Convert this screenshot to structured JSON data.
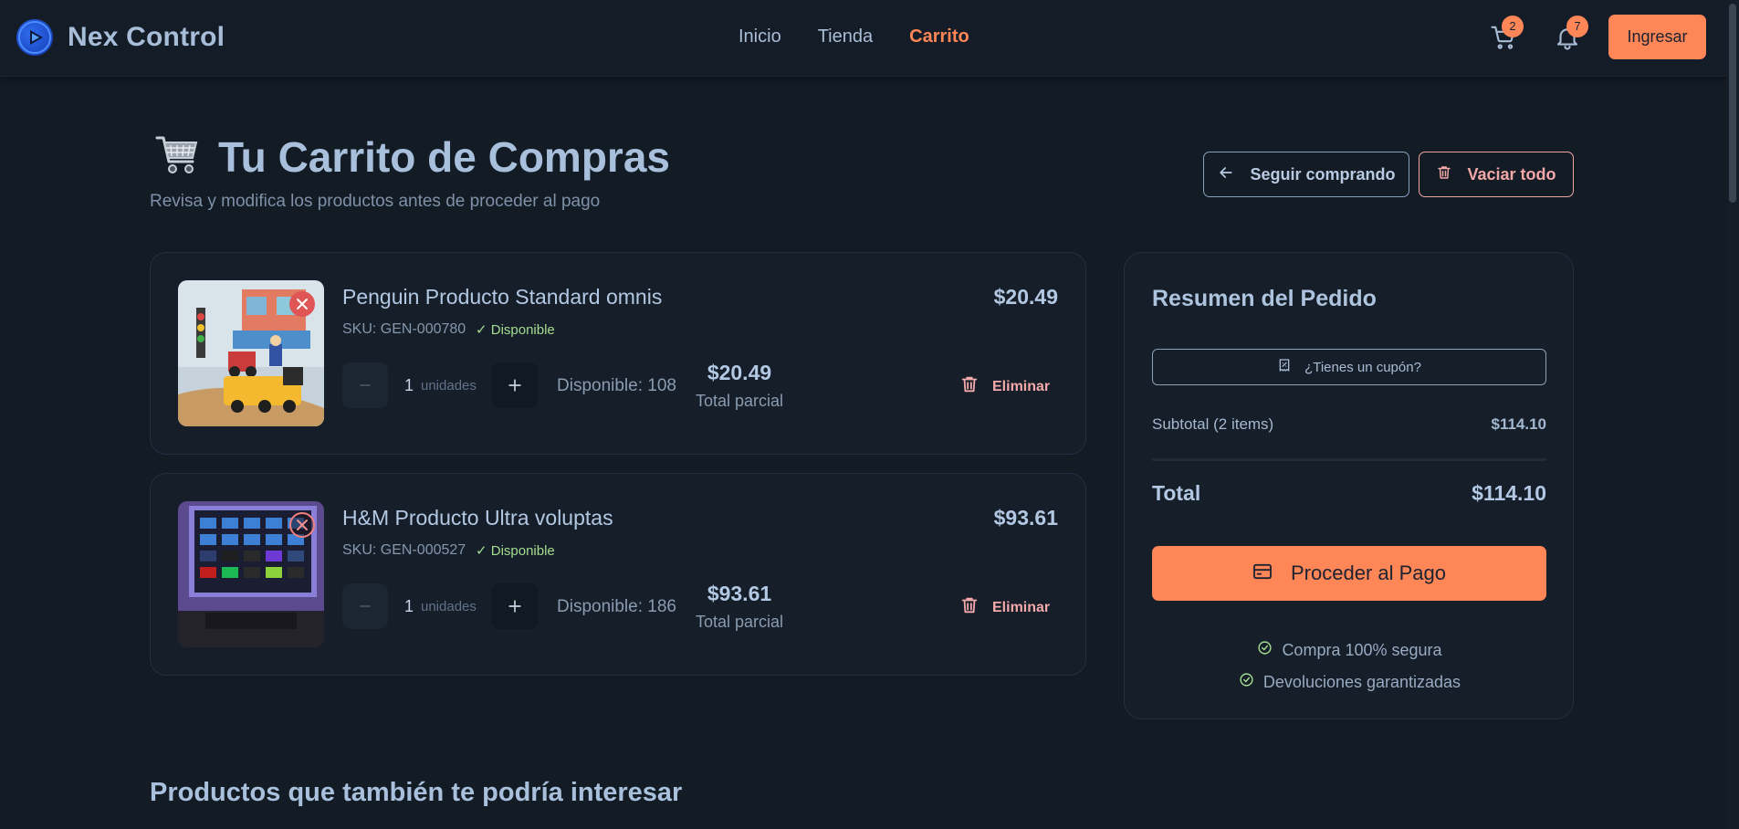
{
  "brand": {
    "name": "Nex Control"
  },
  "nav": {
    "items": [
      "Inicio",
      "Tienda",
      "Carrito"
    ],
    "active": "Carrito"
  },
  "header": {
    "cart_count": "2",
    "notif_count": "7",
    "login_label": "Ingresar"
  },
  "page": {
    "title": "Tu Carrito de Compras",
    "subtitle": "Revisa y modifica los productos antes de proceder al pago",
    "keep_shopping_label": "Seguir comprando",
    "empty_label": "Vaciar todo"
  },
  "items": [
    {
      "name": "Penguin Producto Standard omnis",
      "price": "$20.49",
      "sku": "SKU: GEN-000780",
      "availability": "✓ Disponible",
      "quantity": "1",
      "unit": "unidades",
      "stock": "Disponible: 108",
      "subtotal": "$20.49",
      "subtotal_label": "Total parcial",
      "remove_label": "Eliminar"
    },
    {
      "name": "H&M Producto Ultra voluptas",
      "price": "$93.61",
      "sku": "SKU: GEN-000527",
      "availability": "✓ Disponible",
      "quantity": "1",
      "unit": "unidades",
      "stock": "Disponible: 186",
      "subtotal": "$93.61",
      "subtotal_label": "Total parcial",
      "remove_label": "Eliminar"
    }
  ],
  "summary": {
    "title": "Resumen del Pedido",
    "coupon_label": "¿Tienes un cupón?",
    "subtotal_label": "Subtotal (2 items)",
    "subtotal_value": "$114.10",
    "total_label": "Total",
    "total_value": "$114.10",
    "pay_label": "Proceder al Pago",
    "guarantee_1": "Compra 100% segura",
    "guarantee_2": "Devoluciones garantizadas"
  },
  "related": {
    "title": "Productos que también te podría interesar"
  },
  "colors": {
    "accent": "#ff8656",
    "background": "#131b25",
    "danger": "#f4a9aa",
    "success": "#a5dd90"
  }
}
